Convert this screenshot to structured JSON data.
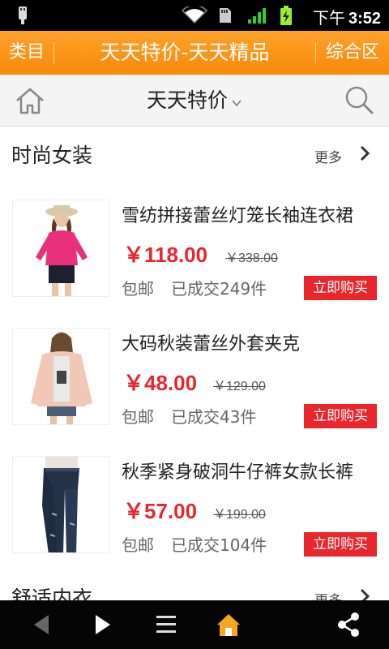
{
  "status": {
    "ampm": "下午",
    "time": "3:52"
  },
  "titlebar": {
    "left": "类目",
    "title": "天天特价-天天精品",
    "right": "综合区"
  },
  "subheader": {
    "selected": "天天特价"
  },
  "sections": [
    {
      "name": "时尚女装",
      "more": "更多",
      "products": [
        {
          "name": "雪纺拼接蕾丝灯笼长袖连衣裙",
          "price": "￥118.00",
          "old_price": "￥338.00",
          "shipping": "包邮",
          "sold": "已成交249件",
          "buy": "立即购买"
        },
        {
          "name": "大码秋装蕾丝外套夹克",
          "price": "￥48.00",
          "old_price": "￥129.00",
          "shipping": "包邮",
          "sold": "已成交43件",
          "buy": "立即购买"
        },
        {
          "name": "秋季紧身破洞牛仔裤女款长裤",
          "price": "￥57.00",
          "old_price": "￥199.00",
          "shipping": "包邮",
          "sold": "已成交104件",
          "buy": "立即购买"
        }
      ]
    },
    {
      "name": "舒适内衣",
      "more": "更多"
    }
  ],
  "colors": {
    "accent": "#f7890a",
    "price": "#e8262b",
    "buy_button": "#e8262b",
    "home_nav": "#f5a623"
  }
}
